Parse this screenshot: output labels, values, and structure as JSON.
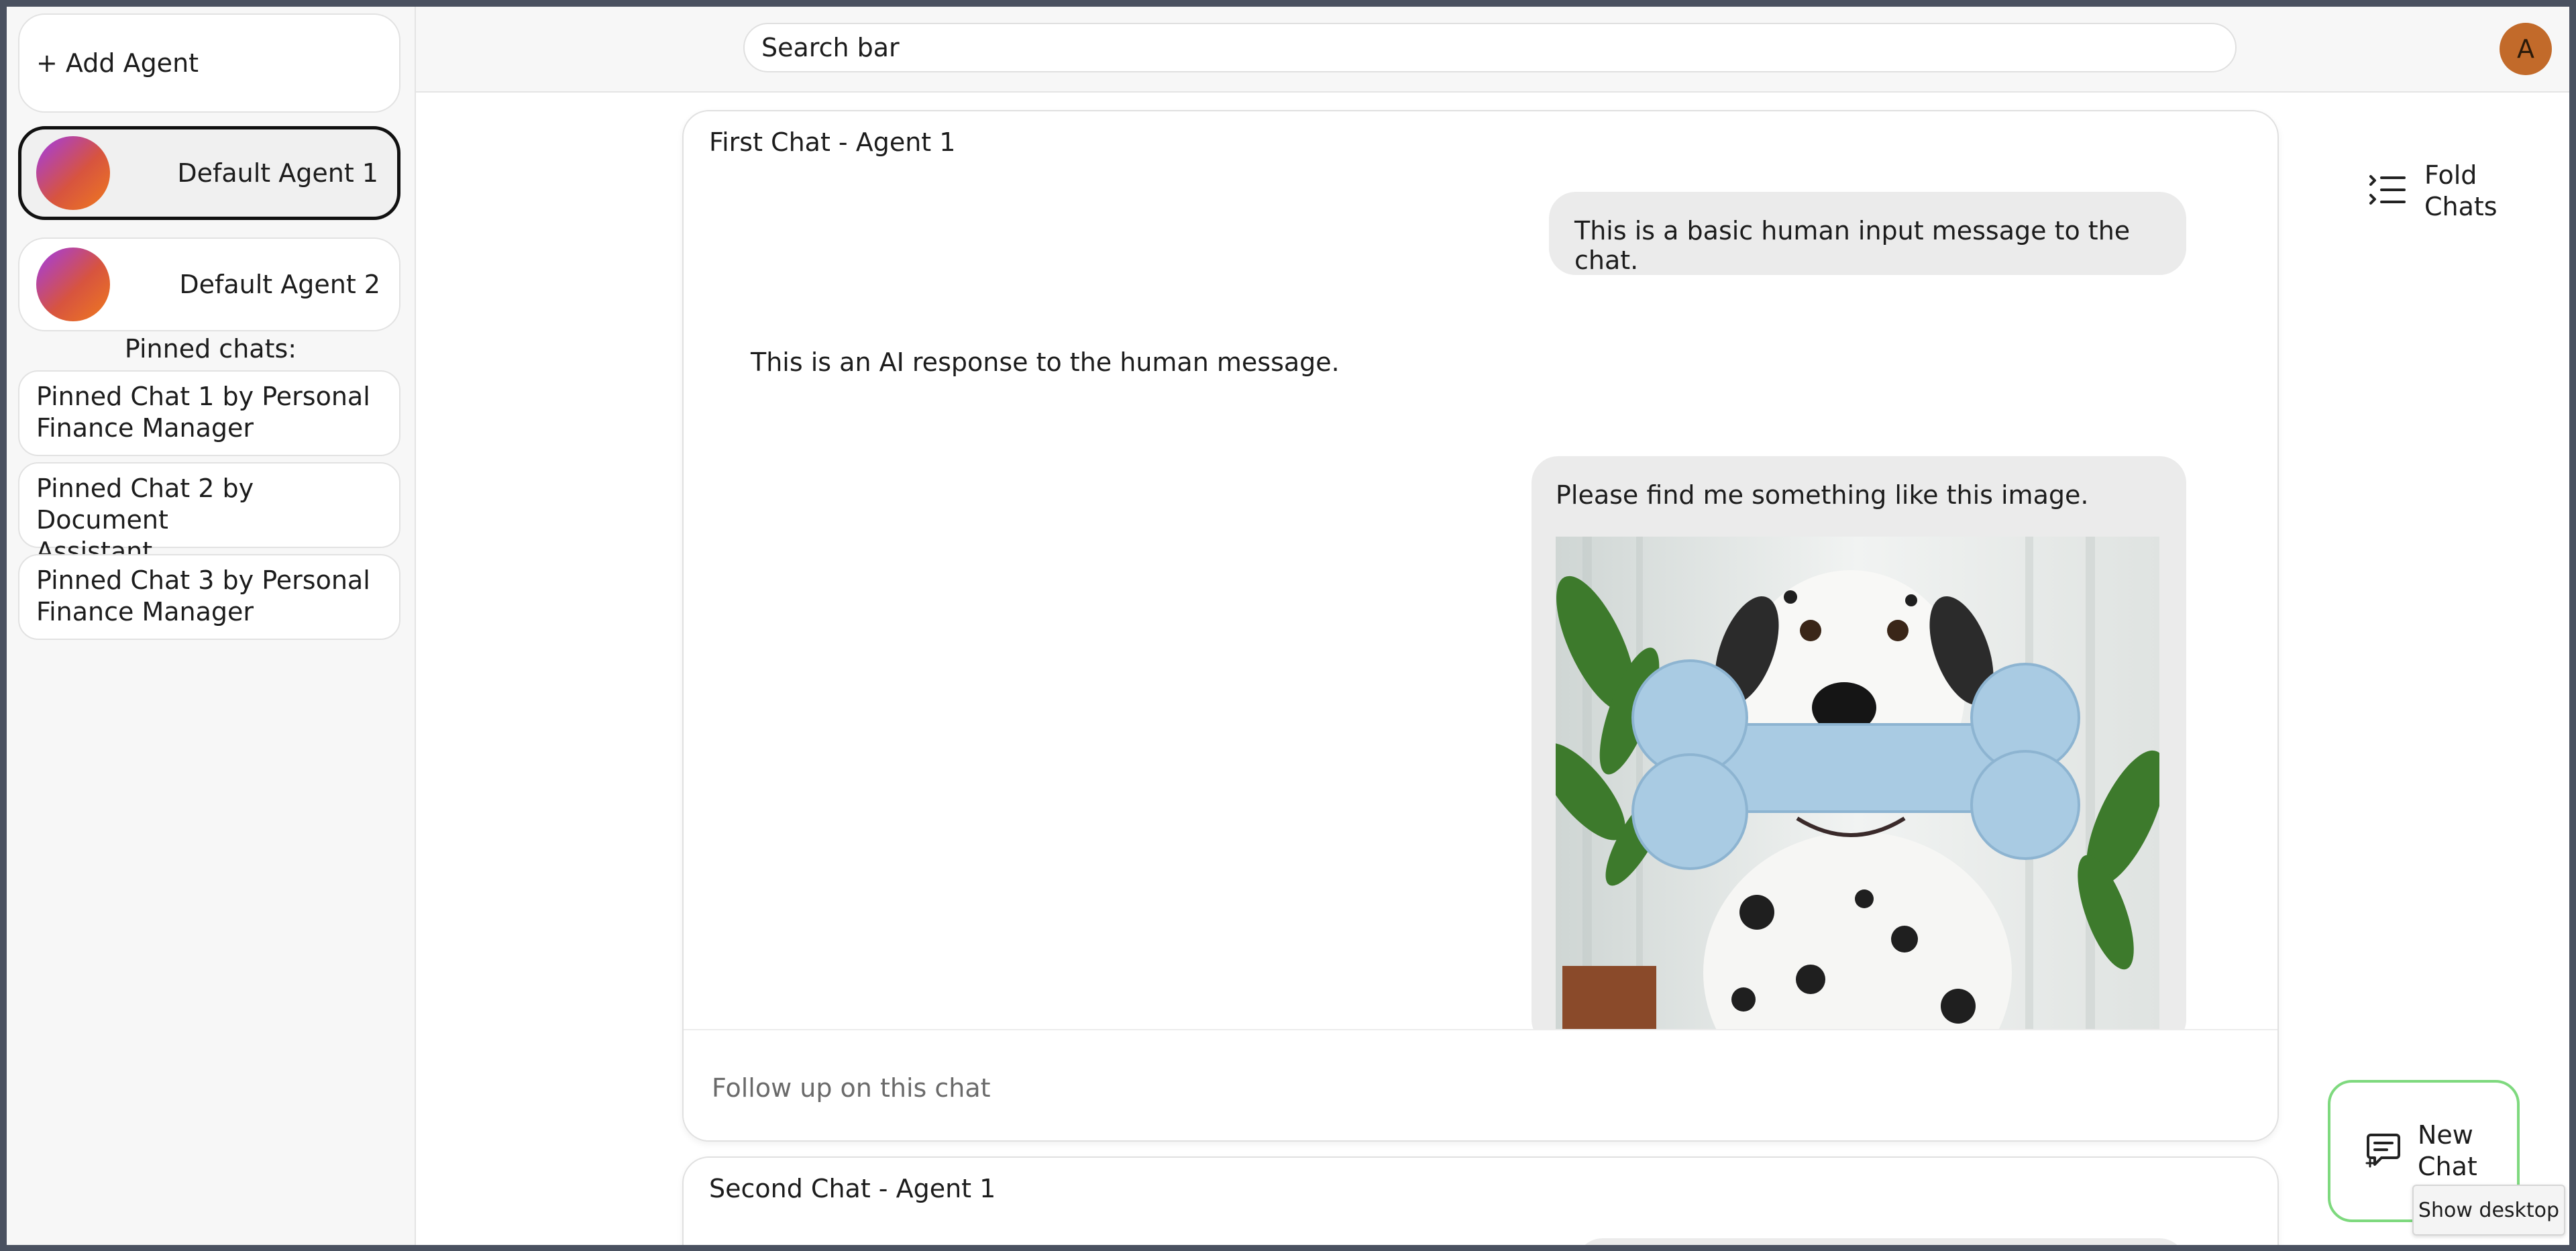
{
  "sidebar": {
    "add_agent_label": "+ Add Agent",
    "agents": [
      {
        "name": "Default Agent 1",
        "selected": true
      },
      {
        "name": "Default Agent 2",
        "selected": false
      }
    ],
    "pinned_title": "Pinned chats:",
    "pinned_chats": [
      {
        "line1": "Pinned Chat 1 by Personal",
        "line2": "Finance Manager"
      },
      {
        "line1": "Pinned Chat 2 by Document",
        "line2": "Assistant"
      },
      {
        "line1": "Pinned Chat 3 by Personal",
        "line2": "Finance Manager"
      }
    ]
  },
  "header": {
    "search_placeholder": "Search bar",
    "user_initial": "A"
  },
  "chats": [
    {
      "title": "First Chat - Agent 1",
      "messages": {
        "human_1": "This is a basic human input message to the chat.",
        "ai_1": "This is an AI response to the human message.",
        "human_2": "Please find me something like this image."
      },
      "image_icon": "dalmatian-with-toy-bone-image",
      "follow_up_placeholder": "Follow up on this chat"
    },
    {
      "title": "Second Chat - Agent 1"
    }
  ],
  "fold_chats": {
    "line1": "Fold",
    "line2": "Chats",
    "icon": "list-fold-icon"
  },
  "new_chat": {
    "line1": "New",
    "line2": "Chat",
    "icon": "chat-add-icon"
  },
  "tooltip": "Show desktop",
  "colors": {
    "selected_border": "#111111",
    "new_chat_border": "#7ed97e",
    "user_avatar": "#c26a2a",
    "bubble": "#ebebeb"
  }
}
